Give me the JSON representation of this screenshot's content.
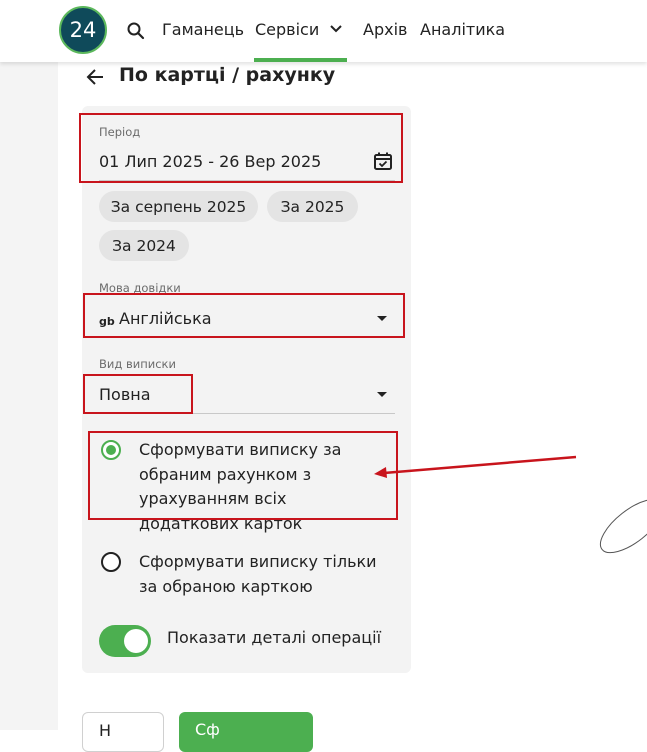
{
  "nav": {
    "logo_text": "24",
    "items": [
      "Гаманець",
      "Сервіси",
      "Архів",
      "Аналітика"
    ],
    "active": "Сервіси",
    "accent_color": "#4caf50",
    "logo_color": "#0f4a5a"
  },
  "page": {
    "title": "По картці / рахунку"
  },
  "form": {
    "period": {
      "label": "Період",
      "value": "01 Лип 2025 - 26 Вер 2025"
    },
    "chips": [
      "За серпень 2025",
      "За 2025",
      "За 2024"
    ],
    "language": {
      "label": "Мова довідки",
      "flag_code": "GB",
      "value": "Англійська"
    },
    "statement_type": {
      "label": "Вид виписки",
      "value": "Повна"
    },
    "radio_options": [
      {
        "label": "Сформувати виписку за обраним рахунком з урахуванням всіх додаткових карток",
        "checked": true
      },
      {
        "label": "Сформувати виписку тільки за обраною карткою",
        "checked": false
      }
    ],
    "toggle": {
      "label": "Показати деталі операції",
      "on": true
    }
  },
  "buttons": {
    "secondary_label": "Н",
    "primary_label": "Сф"
  },
  "annotation_color": "#c8141c"
}
